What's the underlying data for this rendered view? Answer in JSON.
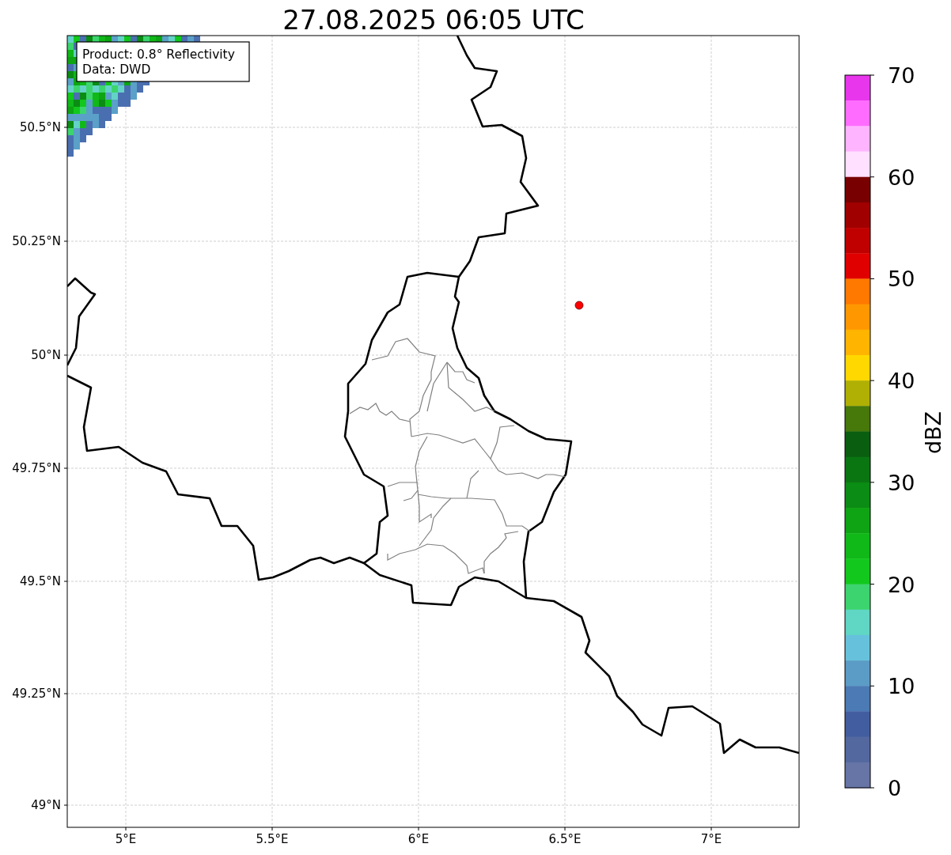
{
  "title": "27.08.2025 06:05 UTC",
  "info_box": {
    "lines": [
      "Product: 0.8° Reflectivity",
      "Data: DWD"
    ]
  },
  "latitude_labels": [
    "50.5°N",
    "50.25°N",
    "50°N",
    "49.75°N",
    "49.5°N",
    "49.25°N",
    "49°N"
  ],
  "longitude_labels": [
    "5°E",
    "5.5°E",
    "6°E",
    "6.5°E",
    "7°E"
  ],
  "colorbar": {
    "label": "dBZ",
    "ticks": [
      "70",
      "60",
      "50",
      "40",
      "30",
      "20",
      "10",
      "0"
    ],
    "bins": [
      {
        "color": "#e836ec"
      },
      {
        "color": "#ff6cff"
      },
      {
        "color": "#ffb4ff"
      },
      {
        "color": "#ffe0ff"
      },
      {
        "color": "#780000"
      },
      {
        "color": "#a00000"
      },
      {
        "color": "#c00000"
      },
      {
        "color": "#e00000"
      },
      {
        "color": "#ff7800"
      },
      {
        "color": "#ff9800"
      },
      {
        "color": "#ffb400"
      },
      {
        "color": "#ffd800"
      },
      {
        "color": "#b0b004"
      },
      {
        "color": "#46780a"
      },
      {
        "color": "#0a5e10"
      },
      {
        "color": "#0a7612"
      },
      {
        "color": "#0b8c14"
      },
      {
        "color": "#0ea414"
      },
      {
        "color": "#10b818"
      },
      {
        "color": "#12c81c"
      },
      {
        "color": "#3cd46e"
      },
      {
        "color": "#60d6c4"
      },
      {
        "color": "#66c2dc"
      },
      {
        "color": "#5a9cc6"
      },
      {
        "color": "#4b7ab4"
      },
      {
        "color": "#435ea0"
      },
      {
        "color": "#5468a0"
      },
      {
        "color": "#6674a6"
      }
    ]
  }
}
